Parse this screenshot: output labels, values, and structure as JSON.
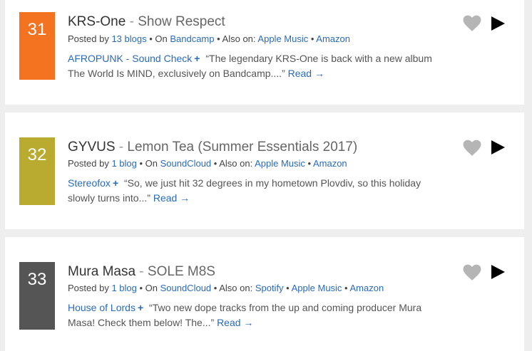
{
  "tracks": [
    {
      "rank": "31",
      "rank_color": "#f47321",
      "artist": "KRS-One",
      "separator": " - ",
      "title": "Show Respect",
      "posted_prefix": "Posted by ",
      "posted_link": "13 blogs",
      "on_text": " • On ",
      "on_link": "Bandcamp",
      "also_text": " • Also on: ",
      "also_links": [
        "Apple Music",
        "Amazon"
      ],
      "blog": "AFROPUNK - Sound Check",
      "plus": "+",
      "excerpt": "“The legendary KRS-One is back with a new album The World Is MIND, exclusively on Bandcamp....”",
      "read_label": "Read →",
      "heart_icon": "heart-icon",
      "play_icon": "play-icon"
    },
    {
      "rank": "32",
      "rank_color": "#b8ab30",
      "artist": "GYVUS",
      "separator": " - ",
      "title": "Lemon Tea (Summer Essentials 2017)",
      "posted_prefix": "Posted by ",
      "posted_link": "1 blog",
      "on_text": " • On ",
      "on_link": "SoundCloud",
      "also_text": " • Also on: ",
      "also_links": [
        "Apple Music",
        "Amazon"
      ],
      "blog": "Stereofox",
      "plus": "+",
      "excerpt": "“So, we just hit 32 degrees in my hometown Plovdiv, so this holiday slowly turns into...”",
      "read_label": "Read →",
      "heart_icon": "heart-icon",
      "play_icon": "play-icon"
    },
    {
      "rank": "33",
      "rank_color": "#555555",
      "artist": "Mura Masa",
      "separator": " - ",
      "title": "SOLE M8S",
      "posted_prefix": "Posted by ",
      "posted_link": "1 blog",
      "on_text": " • On ",
      "on_link": "SoundCloud",
      "also_text": " • Also on: ",
      "also_links": [
        "Spotify",
        "Apple Music",
        "Amazon"
      ],
      "blog": "House of Lords",
      "plus": "+",
      "excerpt": "“Two new dope tracks from the up and coming producer Mura Masa! Check them below! The...”",
      "read_label": "Read →",
      "heart_icon": "heart-icon",
      "play_icon": "play-icon"
    }
  ],
  "colors": {
    "link": "#2a6bb8",
    "heart": "#b5b5b5",
    "play": "#000000"
  }
}
